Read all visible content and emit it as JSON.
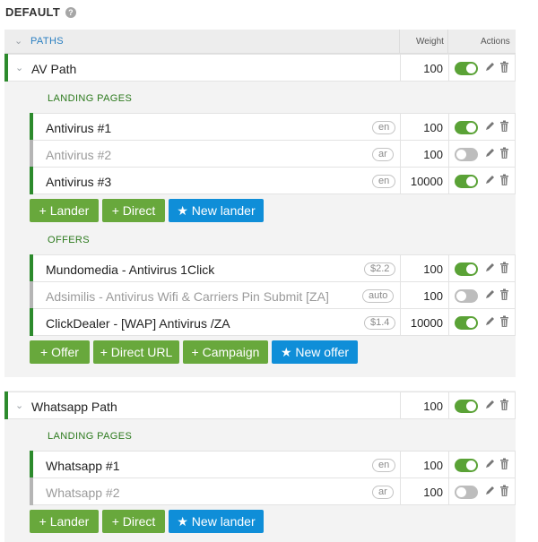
{
  "header": {
    "title": "DEFAULT",
    "help_icon": "question-circle-icon"
  },
  "columns": {
    "paths": "PATHS",
    "weight": "Weight",
    "actions": "Actions"
  },
  "colors": {
    "accent_green": "#68a83c",
    "accent_blue": "#0f8ed8",
    "active_bar": "#2c8a2c",
    "inactive_bar": "#b5b5b5",
    "toggle_on": "#5aa236",
    "toggle_off": "#bdbdbd"
  },
  "paths": [
    {
      "name": "AV Path",
      "weight": "100",
      "enabled": true,
      "landing_label": "LANDING PAGES",
      "landers": [
        {
          "name": "Antivirus #1",
          "badge": "en",
          "weight": "100",
          "enabled": true
        },
        {
          "name": "Antivirus #2",
          "badge": "ar",
          "weight": "100",
          "enabled": false
        },
        {
          "name": "Antivirus #3",
          "badge": "en",
          "weight": "10000",
          "enabled": true
        }
      ],
      "lander_buttons": {
        "lander": "+ Lander",
        "direct": "+ Direct",
        "new_lander": "★ New lander"
      },
      "offers_label": "OFFERS",
      "offers": [
        {
          "name": "Mundomedia - Antivirus 1Click",
          "badge": "$2.2",
          "weight": "100",
          "enabled": true
        },
        {
          "name": "Adsimilis - Antivirus Wifi & Carriers Pin Submit [ZA]",
          "badge": "auto",
          "weight": "100",
          "enabled": false
        },
        {
          "name": "ClickDealer - [WAP] Antivirus /ZA",
          "badge": "$1.4",
          "weight": "10000",
          "enabled": true
        }
      ],
      "offer_buttons": {
        "offer": "+ Offer",
        "direct_url": "+ Direct URL",
        "campaign": "+ Campaign",
        "new_offer": "★ New offer"
      }
    },
    {
      "name": "Whatsapp Path",
      "weight": "100",
      "enabled": true,
      "landing_label": "LANDING PAGES",
      "landers": [
        {
          "name": "Whatsapp #1",
          "badge": "en",
          "weight": "100",
          "enabled": true
        },
        {
          "name": "Whatsapp #2",
          "badge": "ar",
          "weight": "100",
          "enabled": false
        }
      ],
      "lander_buttons": {
        "lander": "+ Lander",
        "direct": "+ Direct",
        "new_lander": "★ New lander"
      }
    }
  ]
}
